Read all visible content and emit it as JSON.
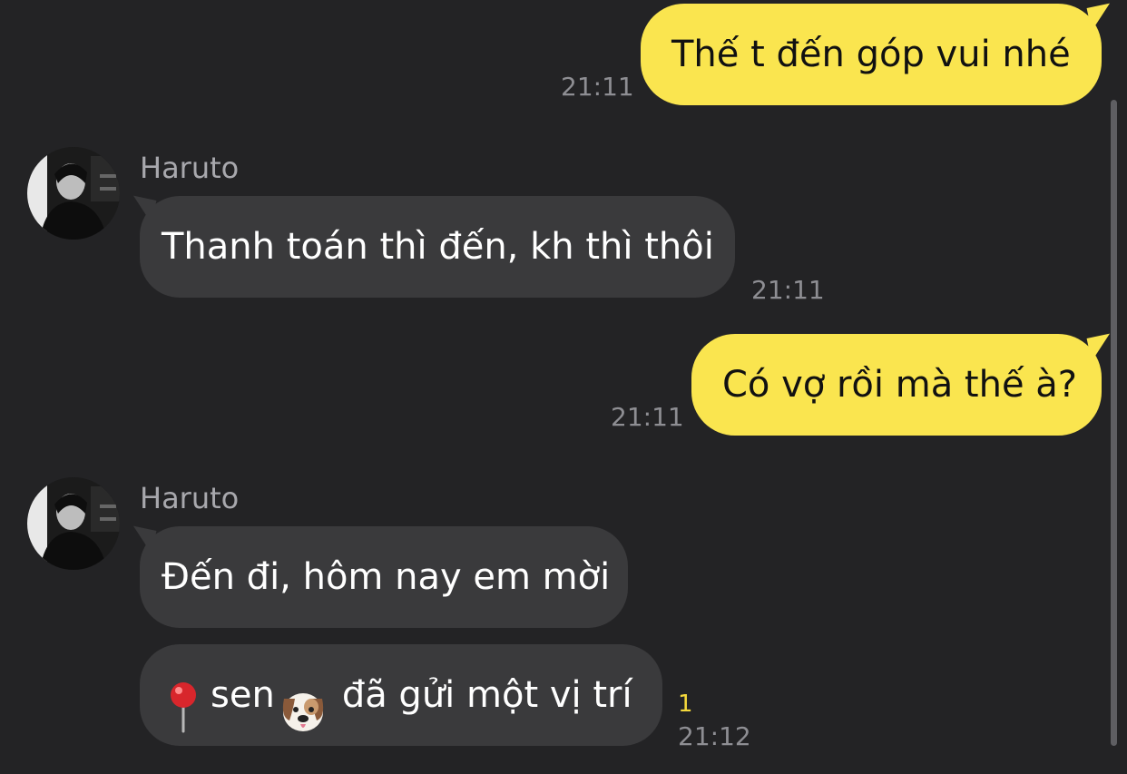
{
  "messages": [
    {
      "direction": "out",
      "text": "Thế t đến góp vui nhé",
      "time": "21:11"
    },
    {
      "direction": "in",
      "sender": "Haruto",
      "text": "Thanh toán thì đến, kh thì thôi",
      "time": "21:11"
    },
    {
      "direction": "out",
      "text": "Có vợ rồi mà thế à?",
      "time": "21:11"
    },
    {
      "direction": "in",
      "sender": "Haruto",
      "text": "Đến đi, hôm nay em mời"
    },
    {
      "direction": "in",
      "location_sender": "sen",
      "location_text": "đã gửi một vị trí",
      "unread": "1",
      "time": "21:12",
      "icons": [
        "map-pin-icon",
        "dog-face-icon"
      ]
    }
  ],
  "colors": {
    "background": "#232325",
    "outgoing_bubble": "#fae54f",
    "incoming_bubble": "#3a3a3c",
    "timestamp": "#8e8e93",
    "unread_count": "#f4d83c"
  }
}
